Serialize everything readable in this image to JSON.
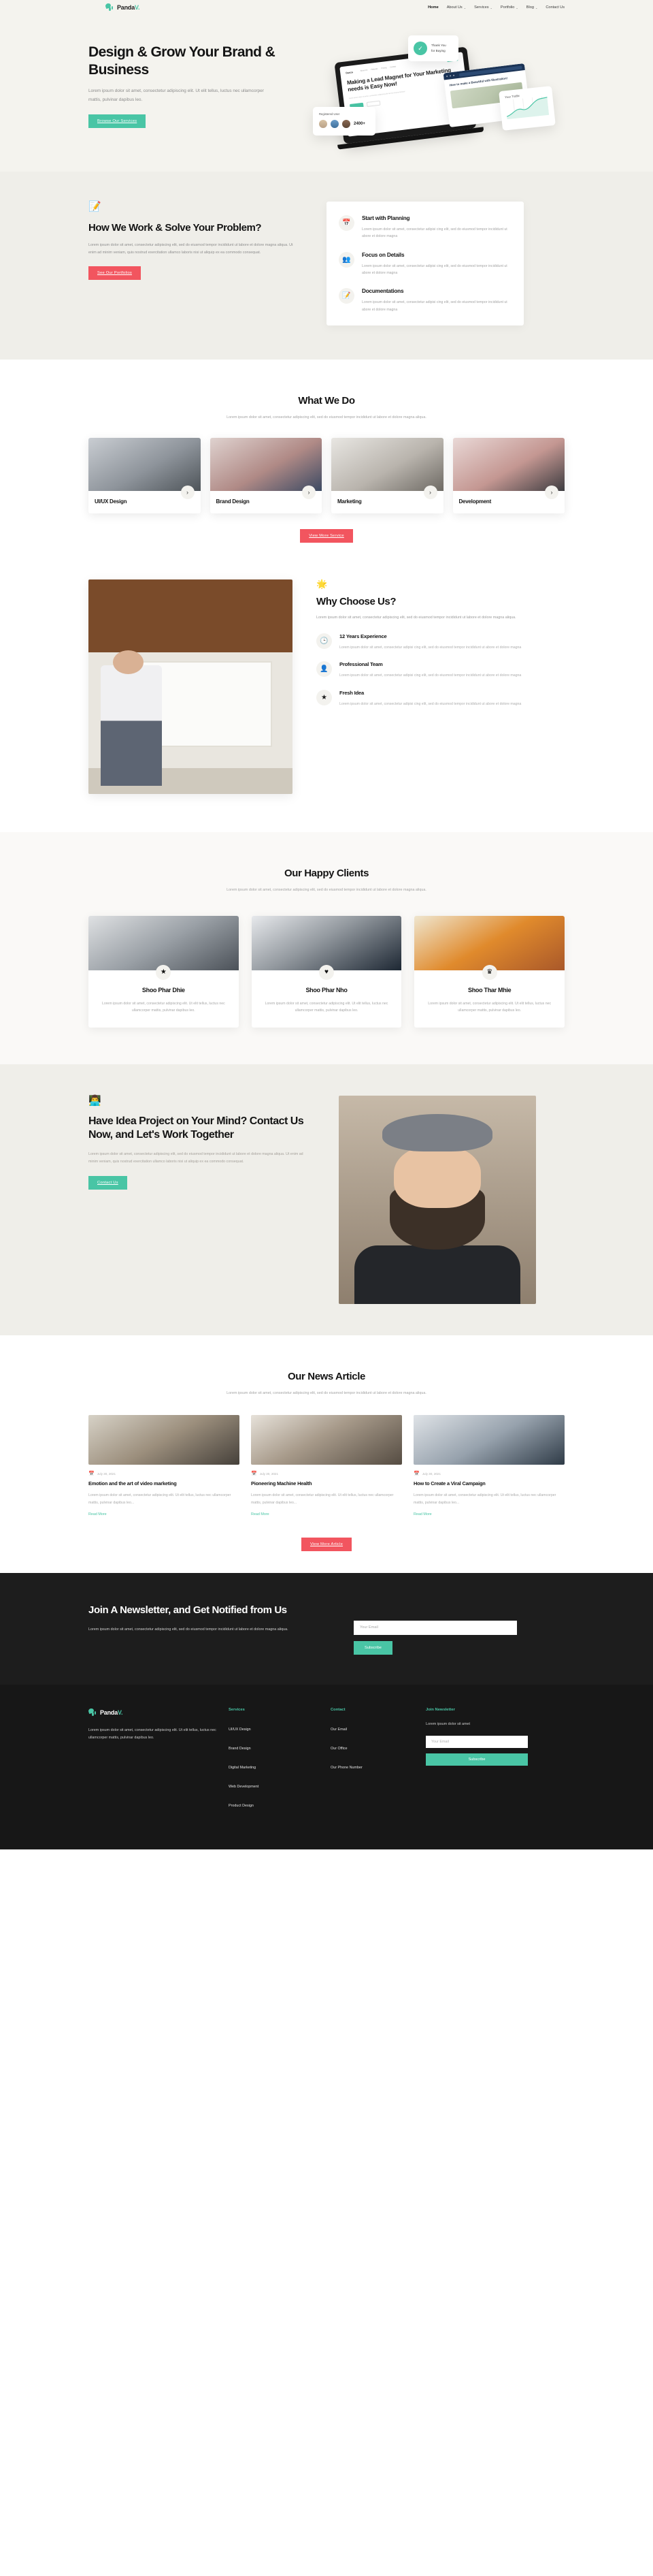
{
  "brand": {
    "name": "Panda",
    "accent_letter": "V.",
    "accent_color": "#49c5a5"
  },
  "nav": {
    "items": [
      {
        "label": "Home",
        "caret": "",
        "active": true
      },
      {
        "label": "About Us",
        "caret": "⌄",
        "active": false
      },
      {
        "label": "Services",
        "caret": "⌄",
        "active": false
      },
      {
        "label": "Portfolio",
        "caret": "⌄",
        "active": false
      },
      {
        "label": "Blog",
        "caret": "⌄",
        "active": false
      },
      {
        "label": "Contact Us",
        "caret": "",
        "active": false
      }
    ]
  },
  "hero": {
    "title": "Design & Grow Your Brand & Business",
    "subtitle": "Lorem ipsum dolor sit amet, consectetur adipiscing elit. Ut elit tellus, luctus nec ullamcorper mattis, pulvinar dapibus leo.",
    "cta": "Browse Our Services",
    "art": {
      "thankyou_line1": "Thank You",
      "thankyou_line2": "for Buying",
      "check_icon": "✓",
      "registered_label": "Registered User",
      "registered_count": "2400+",
      "laptop_logo": "Danza",
      "laptop_nav": [
        "About Us",
        "Features",
        "Pricing",
        "Contact"
      ],
      "laptop_title": "Making a Lead Magnet for Your Marketing needs is Easy Now!",
      "laptop_body": "Lorem ipsum dolor sit amet, consectetur adipiscing elit sed do eiusmod tempor.",
      "browser_headline": "How to make a Beautiful with Illustration!",
      "traffic_label": "Your Traffic"
    }
  },
  "how_we_work": {
    "emoji": "📝",
    "title": "How We Work & Solve Your Problem?",
    "paragraph": "Lorem ipsum dolor sit amet, consectetur adipiscing elit, sed do eiusmod tempor incididunt ut labore et dolore magna aliqua. Ut enim ad minim veniam, quis nostrud exercitation ullamco laboris nisi ut aliquip ex ea commodo consequat.",
    "cta": "See Our Portfolios",
    "items": [
      {
        "icon": "📅",
        "icon_name": "calendar-icon",
        "title": "Start with Planning",
        "text": "Lorem ipsum dolor sit amet, consectetur adipisi cing elit, sed do eiusmod tempor incididunt ut abore et dolore magna"
      },
      {
        "icon": "👥",
        "icon_name": "people-icon",
        "title": "Focus on Details",
        "text": "Lorem ipsum dolor sit amet, consectetur adipisi cing elit, sed do eiusmod tempor incididunt ut abore et dolore magna"
      },
      {
        "icon": "📝",
        "icon_name": "edit-document-icon",
        "title": "Documentations",
        "text": "Lorem ipsum dolor sit amet, consectetur adipisi cing elit, sed do eiusmod tempor incididunt ut abore et dolore magna"
      }
    ]
  },
  "what_we_do": {
    "title": "What We Do",
    "paragraph": "Lorem ipsum dolor sit amet, consectetur adipiscing elit, sed do eiusmod tempor incididunt ut labore et dolore magna aliqua.",
    "services": [
      {
        "name": "UI/UX Design",
        "arrow": "›"
      },
      {
        "name": "Brand Design",
        "arrow": "›"
      },
      {
        "name": "Marketing",
        "arrow": "›"
      },
      {
        "name": "Development",
        "arrow": "›"
      }
    ],
    "cta": "View More Service"
  },
  "why_choose_us": {
    "emoji": "🌟",
    "title": "Why Choose Us?",
    "paragraph": "Lorem ipsum dolor sit amet, consectetur adipiscing elit, sed do eiusmod tempor incididunt ut labore et dolore magna aliqua.",
    "items": [
      {
        "icon": "🕒",
        "icon_name": "clock-icon",
        "title": "12 Years Experience",
        "text": "Lorem ipsum dolor sit amet, consectetur adipisi cing elit, sed do eiusmod tempor incididunt ut abore et dolore magna"
      },
      {
        "icon": "👤",
        "icon_name": "person-tie-icon",
        "title": "Professional Team",
        "text": "Lorem ipsum dolor sit amet, consectetur adipisi cing elit, sed do eiusmod tempor incididunt ut abore et dolore magna"
      },
      {
        "icon": "★",
        "icon_name": "star-icon",
        "title": "Fresh Idea",
        "text": "Lorem ipsum dolor sit amet, consectetur adipisi cing elit, sed do eiusmod tempor incididunt ut abore et dolore magna"
      }
    ]
  },
  "clients": {
    "title": "Our Happy Clients",
    "paragraph": "Lorem ipsum dolor sit amet, consectetur adipiscing elit, sed do eiusmod tempor incididunt ut labore et dolore magna aliqua.",
    "cards": [
      {
        "badge": "★",
        "badge_name": "star-icon",
        "name": "Shoo Phar Dhie",
        "text": "Lorem ipsum dolor sit amet, consectetur adipiscing elit. Ut elit tellus, luctus nec ullamcorper mattis, pulvinar dapibus leo."
      },
      {
        "badge": "♥",
        "badge_name": "heart-icon",
        "name": "Shoo Phar Nho",
        "text": "Lorem ipsum dolor sit amet, consectetur adipiscing elit. Ut elit tellus, luctus nec ullamcorper mattis, pulvinar dapibus leo."
      },
      {
        "badge": "♛",
        "badge_name": "crown-icon",
        "name": "Shoo Thar Mhie",
        "text": "Lorem ipsum dolor sit amet, consectetur adipiscing elit. Ut elit tellus, luctus nec ullamcorper mattis, pulvinar dapibus leo."
      }
    ]
  },
  "idea_cta": {
    "emoji": "👨‍💻",
    "title": "Have Idea Project on Your Mind? Contact Us Now, and Let's Work Together",
    "paragraph": "Lorem ipsum dolor sit amet, consectetur adipiscing elit, sed do eiusmod tempor incididunt ut labore et dolore magna aliqua. Ut enim ad minim veniam, quis nostrud exercitation ullamco laboris nisi ut aliquip ex ea commodo consequat.",
    "cta": "Contact Us"
  },
  "news": {
    "title": "Our News Article",
    "paragraph": "Lorem ipsum dolor sit amet, consectetur adipiscing elit, sed do eiusmod tempor incididunt ut labore et dolore magna aliqua.",
    "cta": "View More Article",
    "articles": [
      {
        "date": "July 30, 2021",
        "title": "Emotion and the art of video marketing",
        "excerpt": "Lorem ipsum dolor sit amet, consectetur adipiscing elit. Ut elit tellus, luctus nec ullamcorper mattis, pulvinar dapibus leo...",
        "link": "Read More"
      },
      {
        "date": "July 30, 2021",
        "title": "Pioneering Machine Health",
        "excerpt": "Lorem ipsum dolor sit amet, consectetur adipiscing elit. Ut elit tellus, luctus nec ullamcorper mattis, pulvinar dapibus leo...",
        "link": "Read More"
      },
      {
        "date": "July 30, 2021",
        "title": "How to Create a Viral Campaign",
        "excerpt": "Lorem ipsum dolor sit amet, consectetur adipiscing elit. Ut elit tellus, luctus nec ullamcorper mattis, pulvinar dapibus leo...",
        "link": "Read More"
      }
    ]
  },
  "newsletter": {
    "title": "Join A Newsletter, and Get Notified from Us",
    "paragraph": "Lorem ipsum dolor sit amet, consectetur adipiscing elit, sed do eiusmod tempor incididunt ut labore et dolore magna aliqua.",
    "placeholder": "Your Email",
    "value": "",
    "button": "Subscribe"
  },
  "footer": {
    "about": "Lorem ipsum dolor sit amet, consectetur adipiscing elit. Ut elit tellus, luctus nec ullamcorper mattis, pulvinar dapibus leo.",
    "services": {
      "heading": "Services",
      "links": [
        "UI/UX Design",
        "Brand Design",
        "Digital Marketing",
        "Web Development",
        "Product Design"
      ]
    },
    "contact": {
      "heading": "Contact",
      "links": [
        "Our Email",
        "Our Office",
        "Our Phone Number"
      ]
    },
    "newsletter": {
      "heading": "Join Newsletter",
      "text": "Lorem ipsum dolor sit amet",
      "placeholder": "Your Email",
      "value": "",
      "button": "Subscribe"
    }
  }
}
